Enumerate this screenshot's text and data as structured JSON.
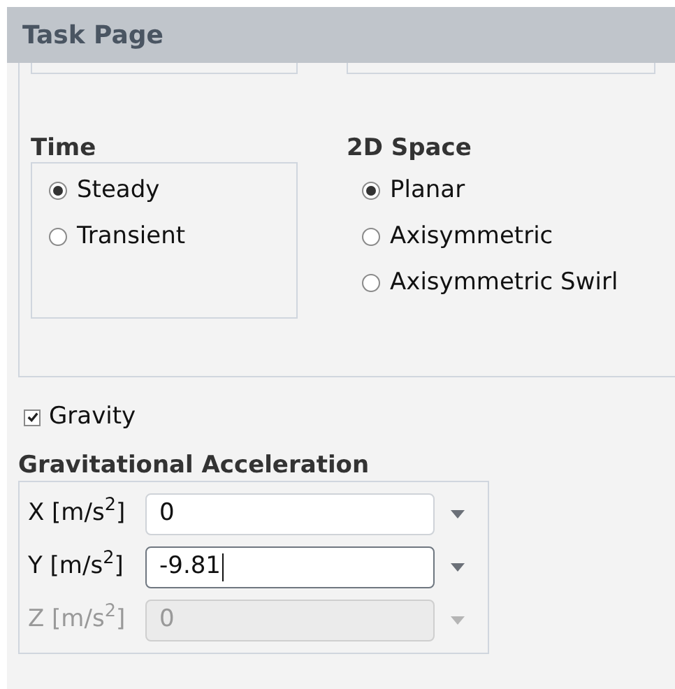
{
  "header": {
    "title": "Task Page"
  },
  "time": {
    "title": "Time",
    "options": [
      {
        "label": "Steady",
        "selected": true
      },
      {
        "label": "Transient",
        "selected": false
      }
    ]
  },
  "space": {
    "title": "2D Space",
    "options": [
      {
        "label": "Planar",
        "selected": true
      },
      {
        "label": "Axisymmetric",
        "selected": false
      },
      {
        "label": "Axisymmetric Swirl",
        "selected": false
      }
    ]
  },
  "gravity": {
    "label": "Gravity",
    "checked": true
  },
  "acceleration": {
    "title": "Gravitational Acceleration",
    "fields": [
      {
        "label": "X [m/s$^{2}$]",
        "value": "0",
        "focused": false,
        "disabled": false
      },
      {
        "label": "Y [m/s$^{2}$]",
        "value": "-9.81",
        "focused": true,
        "disabled": false
      },
      {
        "label": "Z [m/s$^{2}$]",
        "value": "0",
        "focused": false,
        "disabled": true
      }
    ]
  }
}
